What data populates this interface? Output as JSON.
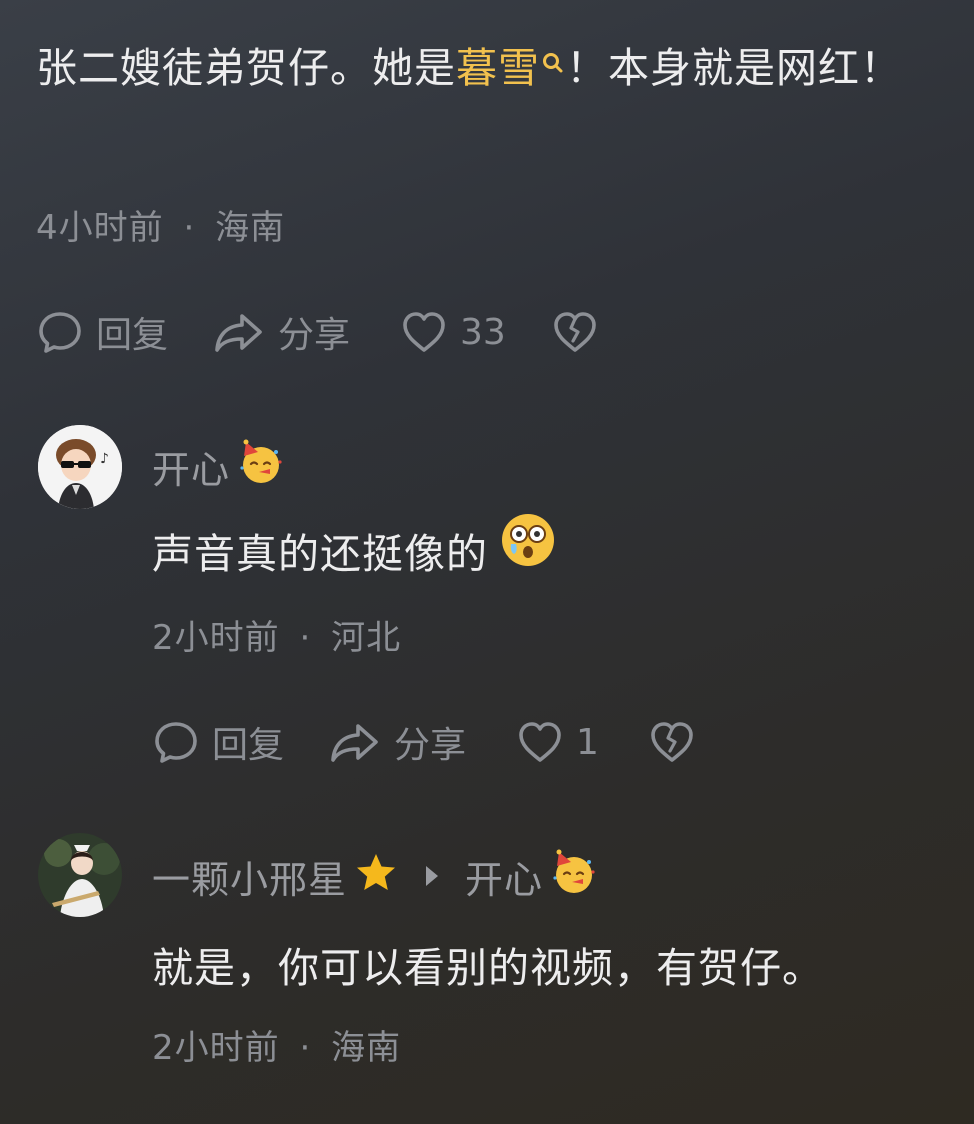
{
  "comment_main": {
    "text_before": "张二嫂徒弟贺仔。她是",
    "highlight": "暮雪",
    "text_after": "！本身就是网红！",
    "time": "4小时前",
    "sep": "·",
    "location": "海南",
    "reply_label": "回复",
    "share_label": "分享",
    "like_count": "33"
  },
  "reply_1": {
    "username": "开心",
    "text": "声音真的还挺像的",
    "time": "2小时前",
    "sep": "·",
    "location": "河北",
    "reply_label": "回复",
    "share_label": "分享",
    "like_count": "1"
  },
  "reply_2": {
    "username": "一颗小邢星",
    "reply_to": "开心",
    "text": "就是，你可以看别的视频，有贺仔。",
    "time": "2小时前",
    "sep": "·",
    "location": "海南"
  },
  "colors": {
    "highlight": "#f2c14e",
    "meta": "#8c8f95",
    "text": "#ededee"
  },
  "icons": [
    "search-icon",
    "comment-icon",
    "share-arrow-icon",
    "heart-icon",
    "broken-heart-icon",
    "party-face-emoji",
    "astonished-face-emoji",
    "star-icon",
    "triangle-right-icon"
  ]
}
